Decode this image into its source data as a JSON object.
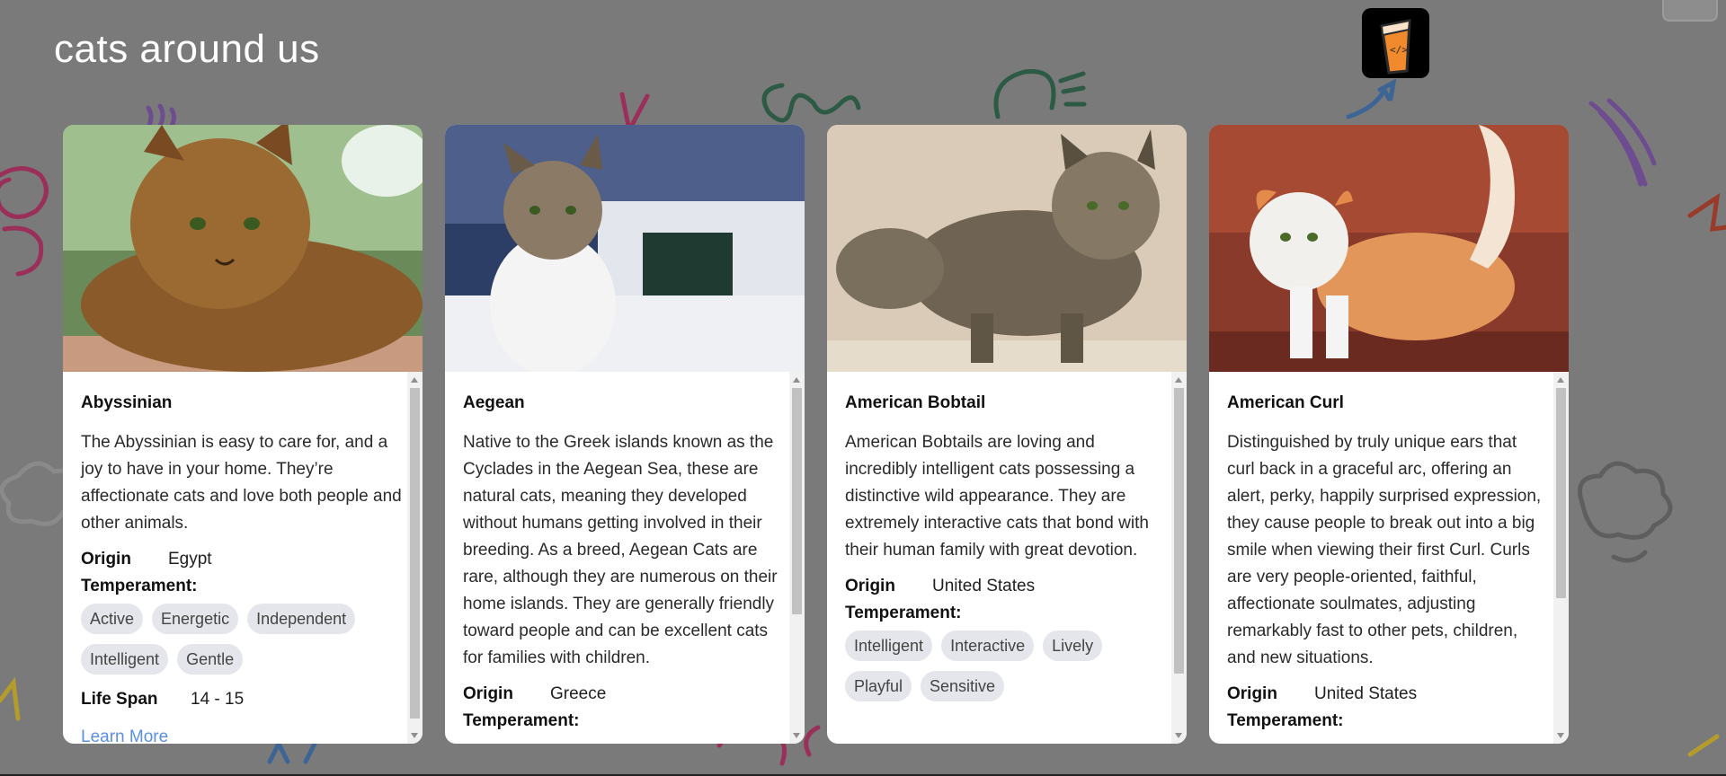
{
  "page": {
    "title": "cats around us",
    "background_color": "#7a7a7a",
    "logo_icon": "codepen-cup-icon"
  },
  "cards": [
    {
      "name": "Abyssinian",
      "image_subject": "ruddy brown abyssinian cat lying down",
      "description": "The Abyssinian is easy to care for, and a joy to have in your home. They’re affectionate cats and love both people and other animals.",
      "origin_label": "Origin",
      "origin": "Egypt",
      "temperament_label": "Temperament:",
      "temperament": [
        "Active",
        "Energetic",
        "Independent",
        "Intelligent",
        "Gentle"
      ],
      "life_span_label": "Life Span",
      "life_span": "14 - 15",
      "learn_more": "Learn More"
    },
    {
      "name": "Aegean",
      "image_subject": "tabby and white cat sitting by the sea",
      "description": "Native to the Greek islands known as the Cyclades in the Aegean Sea, these are natural cats, meaning they developed without humans getting involved in their breeding. As a breed, Aegean Cats are rare, although they are numerous on their home islands. They are generally friendly toward people and can be excellent cats for families with children.",
      "origin_label": "Origin",
      "origin": "Greece",
      "temperament_label": "Temperament:"
    },
    {
      "name": "American Bobtail",
      "image_subject": "long-haired tabby bobtail cat standing",
      "description": "American Bobtails are loving and incredibly intelligent cats possessing a distinctive wild appearance. They are extremely interactive cats that bond with their human family with great devotion.",
      "origin_label": "Origin",
      "origin": "United States",
      "temperament_label": "Temperament:",
      "temperament": [
        "Intelligent",
        "Interactive",
        "Lively",
        "Playful",
        "Sensitive"
      ]
    },
    {
      "name": "American Curl",
      "image_subject": "orange and white curl cat standing",
      "description": "Distinguished by truly unique ears that curl back in a graceful arc, offering an alert, perky, happily surprised expression, they cause people to break out into a big smile when viewing their first Curl. Curls are very people-oriented, faithful, affectionate soulmates, adjusting remarkably fast to other pets, children, and new situations.",
      "origin_label": "Origin",
      "origin": "United States",
      "temperament_label": "Temperament:"
    }
  ]
}
